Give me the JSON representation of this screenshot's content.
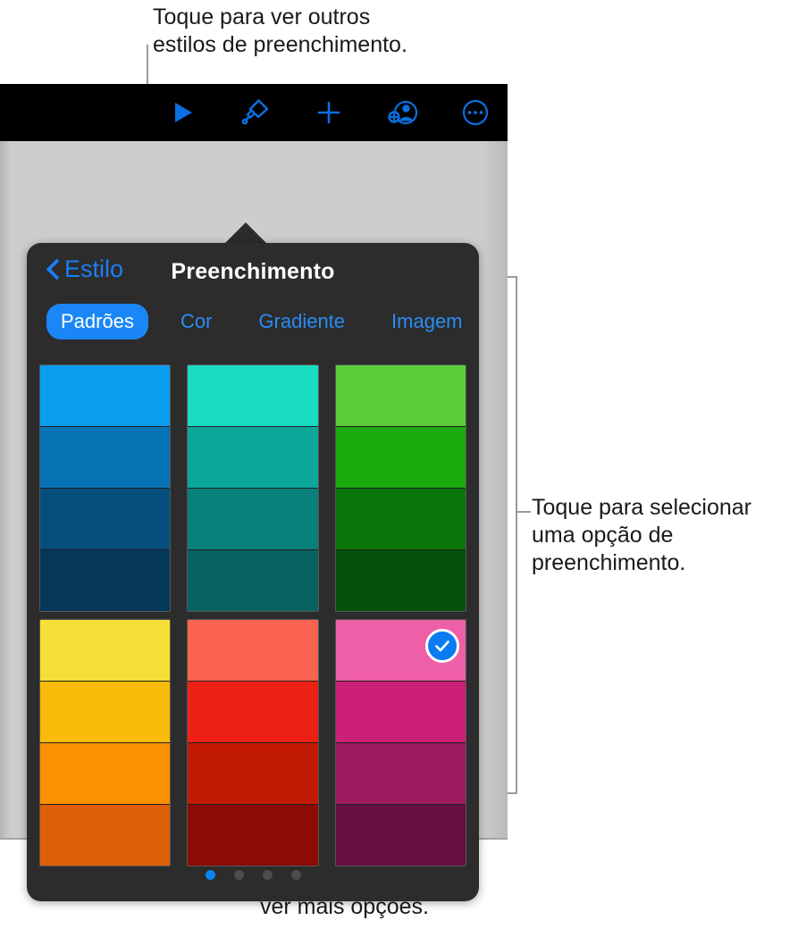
{
  "callouts": {
    "top": "Toque para ver outros\nestilos de preenchimento.",
    "right": "Toque para selecionar\numa opção de\npreenchimento.",
    "bottom": "Passe o dedo para\nver mais opções."
  },
  "toolbar": {
    "icons": [
      {
        "name": "play-icon",
        "label": "Reproduzir"
      },
      {
        "name": "paintbrush-icon",
        "label": "Formato"
      },
      {
        "name": "plus-icon",
        "label": "Inserir"
      },
      {
        "name": "add-person-icon",
        "label": "Colaborar"
      },
      {
        "name": "more-ellipsis-icon",
        "label": "Mais"
      }
    ],
    "accent_color": "#0b6fe0"
  },
  "popover": {
    "back_label": "Estilo",
    "title": "Preenchimento",
    "tabs": [
      {
        "label": "Padrões",
        "active": true
      },
      {
        "label": "Cor",
        "active": false
      },
      {
        "label": "Gradiente",
        "active": false
      },
      {
        "label": "Imagem",
        "active": false
      }
    ],
    "active_tab_color": "#1b87f7",
    "tab_text_color": "#2a8cf5",
    "background": "#2c2c2c"
  },
  "swatch_grid": {
    "selected": {
      "block": 1,
      "column": 2,
      "row": 0
    },
    "blocks": [
      {
        "columns": [
          {
            "name": "blue-column",
            "swatches": [
              "#0b9ef0",
              "#0673b5",
              "#064f7d",
              "#05375a"
            ]
          },
          {
            "name": "teal-column",
            "swatches": [
              "#18dcc4",
              "#0ca79b",
              "#098079",
              "#09615f"
            ]
          },
          {
            "name": "green-column",
            "swatches": [
              "#5bcb3a",
              "#1aaa0c",
              "#0a7509",
              "#05500a"
            ]
          }
        ]
      },
      {
        "columns": [
          {
            "name": "yellow-column",
            "swatches": [
              "#f7df38",
              "#f9bb08",
              "#fa9102",
              "#de5f07"
            ]
          },
          {
            "name": "red-column",
            "swatches": [
              "#fb6450",
              "#ec2113",
              "#c31a06",
              "#8b0c06"
            ]
          },
          {
            "name": "pink-column",
            "swatches": [
              "#ee5fa7",
              "#cc2076",
              "#9e1a60",
              "#670f43"
            ]
          }
        ]
      }
    ],
    "check_icon": "checkmark-icon"
  },
  "page_dots": {
    "count": 4,
    "active_index": 0,
    "active_color": "#0b84f3",
    "inactive_color": "#4d4d4d"
  }
}
